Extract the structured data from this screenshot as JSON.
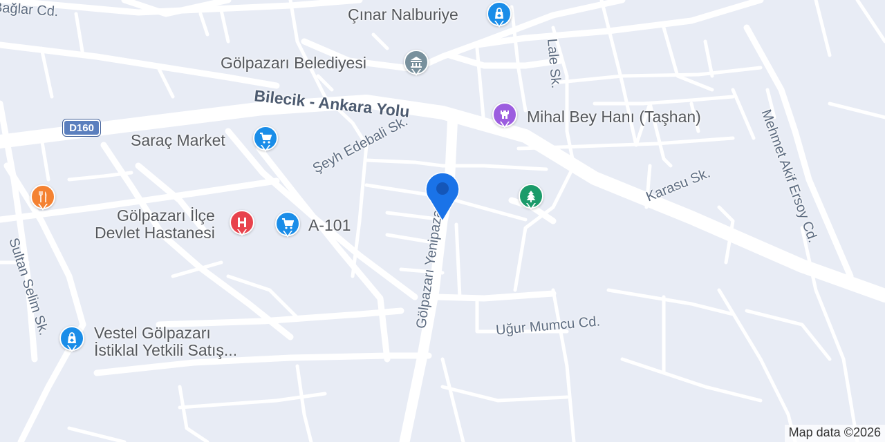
{
  "map": {
    "background_color": "#e8ecf5",
    "road_color": "#ffffff",
    "highway_shield": {
      "label": "D160",
      "color": "#5b7fbe"
    },
    "road_labels": {
      "baglar": "Bağlar Cd.",
      "bilecik_ankara": "Bilecik - Ankara Yolu",
      "seyh_edebali": "Şeyh Edebali Sk.",
      "golpazari_yenipazar": "Gölpazarı Yenipazar Yolu",
      "lale": "Lale Sk.",
      "mehmet_akif": "Mehmet Akif Ersoy Cd.",
      "karasu": "Karasu Sk.",
      "sultan_selim": "Sultan Selim Sk.",
      "ugur_mumcu": "Uğur Mumcu Cd."
    },
    "pois": {
      "cinar": {
        "name": "Çınar Nalburiye",
        "icon": "shopping-bag-icon",
        "color": "#1a8de8"
      },
      "belediye": {
        "name": "Gölpazarı Belediyesi",
        "icon": "government-building-icon",
        "color": "#78909c"
      },
      "mihal": {
        "name": "Mihal Bey Hanı (Taşhan)",
        "icon": "castle-icon",
        "color": "#9c5ddf"
      },
      "sarac": {
        "name": "Saraç Market",
        "icon": "shopping-cart-icon",
        "color": "#1a8de8"
      },
      "restaurant": {
        "icon": "restaurant-icon",
        "color": "#f48232"
      },
      "hastane": {
        "line1": "Gölpazarı İlçe",
        "line2": "Devlet Hastanesi",
        "icon": "hospital-icon",
        "color": "#e8424c"
      },
      "a101": {
        "name": "A-101",
        "icon": "shopping-cart-icon",
        "color": "#1a8de8"
      },
      "park": {
        "icon": "tree-icon",
        "color": "#1c9b6a"
      },
      "vestel": {
        "line1": "Vestel Gölpazarı",
        "line2": "İstiklal Yetkili Satış...",
        "icon": "shopping-bag-icon",
        "color": "#1a8de8"
      }
    },
    "current_location": {
      "icon": "location-marker-icon",
      "color": "#1a73e8"
    },
    "attribution": "Map data ©2026"
  }
}
